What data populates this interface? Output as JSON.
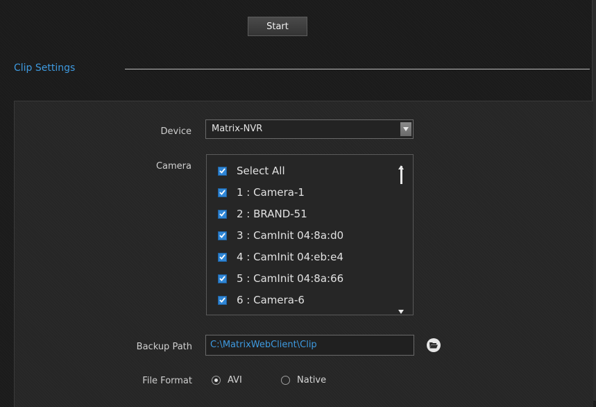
{
  "toolbar": {
    "start_label": "Start"
  },
  "section": {
    "title": "Clip Settings"
  },
  "device": {
    "label": "Device",
    "selected": "Matrix-NVR"
  },
  "camera": {
    "label": "Camera",
    "items": [
      {
        "text": "Select All",
        "checked": true
      },
      {
        "text": "1 : Camera-1",
        "checked": true
      },
      {
        "text": "2 : BRAND-51",
        "checked": true
      },
      {
        "text": "3 : CamInit 04:8a:d0",
        "checked": true
      },
      {
        "text": "4 : CamInit 04:eb:e4",
        "checked": true
      },
      {
        "text": "5 : CamInit 04:8a:66",
        "checked": true
      },
      {
        "text": "6 : Camera-6",
        "checked": true
      }
    ]
  },
  "backup": {
    "label": "Backup Path",
    "value": "C:\\MatrixWebClient\\Clip",
    "browse_icon": "folder-open-icon"
  },
  "file_format": {
    "label": "File Format",
    "options": [
      {
        "label": "AVI",
        "selected": true
      },
      {
        "label": "Native",
        "selected": false
      }
    ]
  },
  "colors": {
    "accent": "#3e9ae0",
    "checkbox": "#2f86d6",
    "background": "#1b1b1b",
    "panel": "#262626"
  }
}
